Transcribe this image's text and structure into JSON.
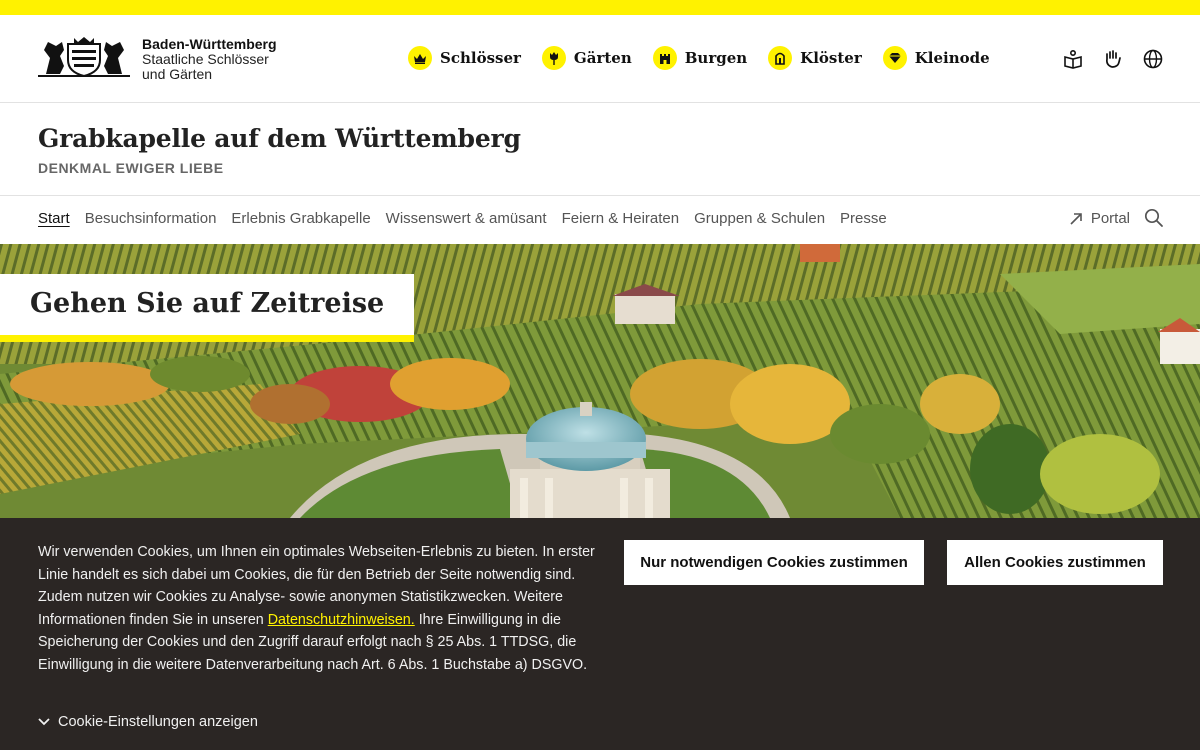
{
  "brand": {
    "line1": "Baden-Württemberg",
    "line2": "Staatliche Schlösser",
    "line3": "und Gärten"
  },
  "categories": [
    {
      "label": "Schlösser",
      "icon": "crown-icon"
    },
    {
      "label": "Gärten",
      "icon": "tulip-icon"
    },
    {
      "label": "Burgen",
      "icon": "castle-icon"
    },
    {
      "label": "Klöster",
      "icon": "church-icon"
    },
    {
      "label": "Kleinode",
      "icon": "gem-icon"
    }
  ],
  "utility_icons": [
    "easy-language-icon",
    "sign-language-icon",
    "globe-icon"
  ],
  "page": {
    "title": "Grabkapelle auf dem Württemberg",
    "subtitle": "DENKMAL EWIGER LIEBE"
  },
  "subnav": {
    "items": [
      "Start",
      "Besuchsinformation",
      "Erlebnis Grabkapelle",
      "Wissenswert & amüsant",
      "Feiern & Heiraten",
      "Gruppen & Schulen",
      "Presse"
    ],
    "active": "Start",
    "portal_label": "Portal"
  },
  "hero": {
    "tag": "Gehen Sie auf Zeitreise"
  },
  "cookie": {
    "text_before": "Wir verwenden Cookies, um Ihnen ein optimales Webseiten-Erlebnis zu bieten. In erster Linie handelt es sich dabei um Cookies, die für den Betrieb der Seite notwendig sind. Zudem nutzen wir Cookies zu Analyse- sowie anonymen Statistikzwecken. Weitere Informationen finden Sie in unseren ",
    "link": "Datenschutzhinweisen.",
    "text_after": " Ihre Einwilligung in die Speicherung der Cookies und den Zugriff darauf erfolgt nach § 25 Abs. 1 TTDSG, die Einwilligung in die weitere Datenverarbeitung nach Art. 6 Abs. 1 Buchstabe a) DSGVO.",
    "settings_label": "Cookie-Einstellungen anzeigen",
    "btn_necessary": "Nur notwendigen Cookies zustimmen",
    "btn_all": "Allen Cookies zustimmen"
  },
  "colors": {
    "accent": "#fff200",
    "cookie_bg": "#2b2624"
  }
}
